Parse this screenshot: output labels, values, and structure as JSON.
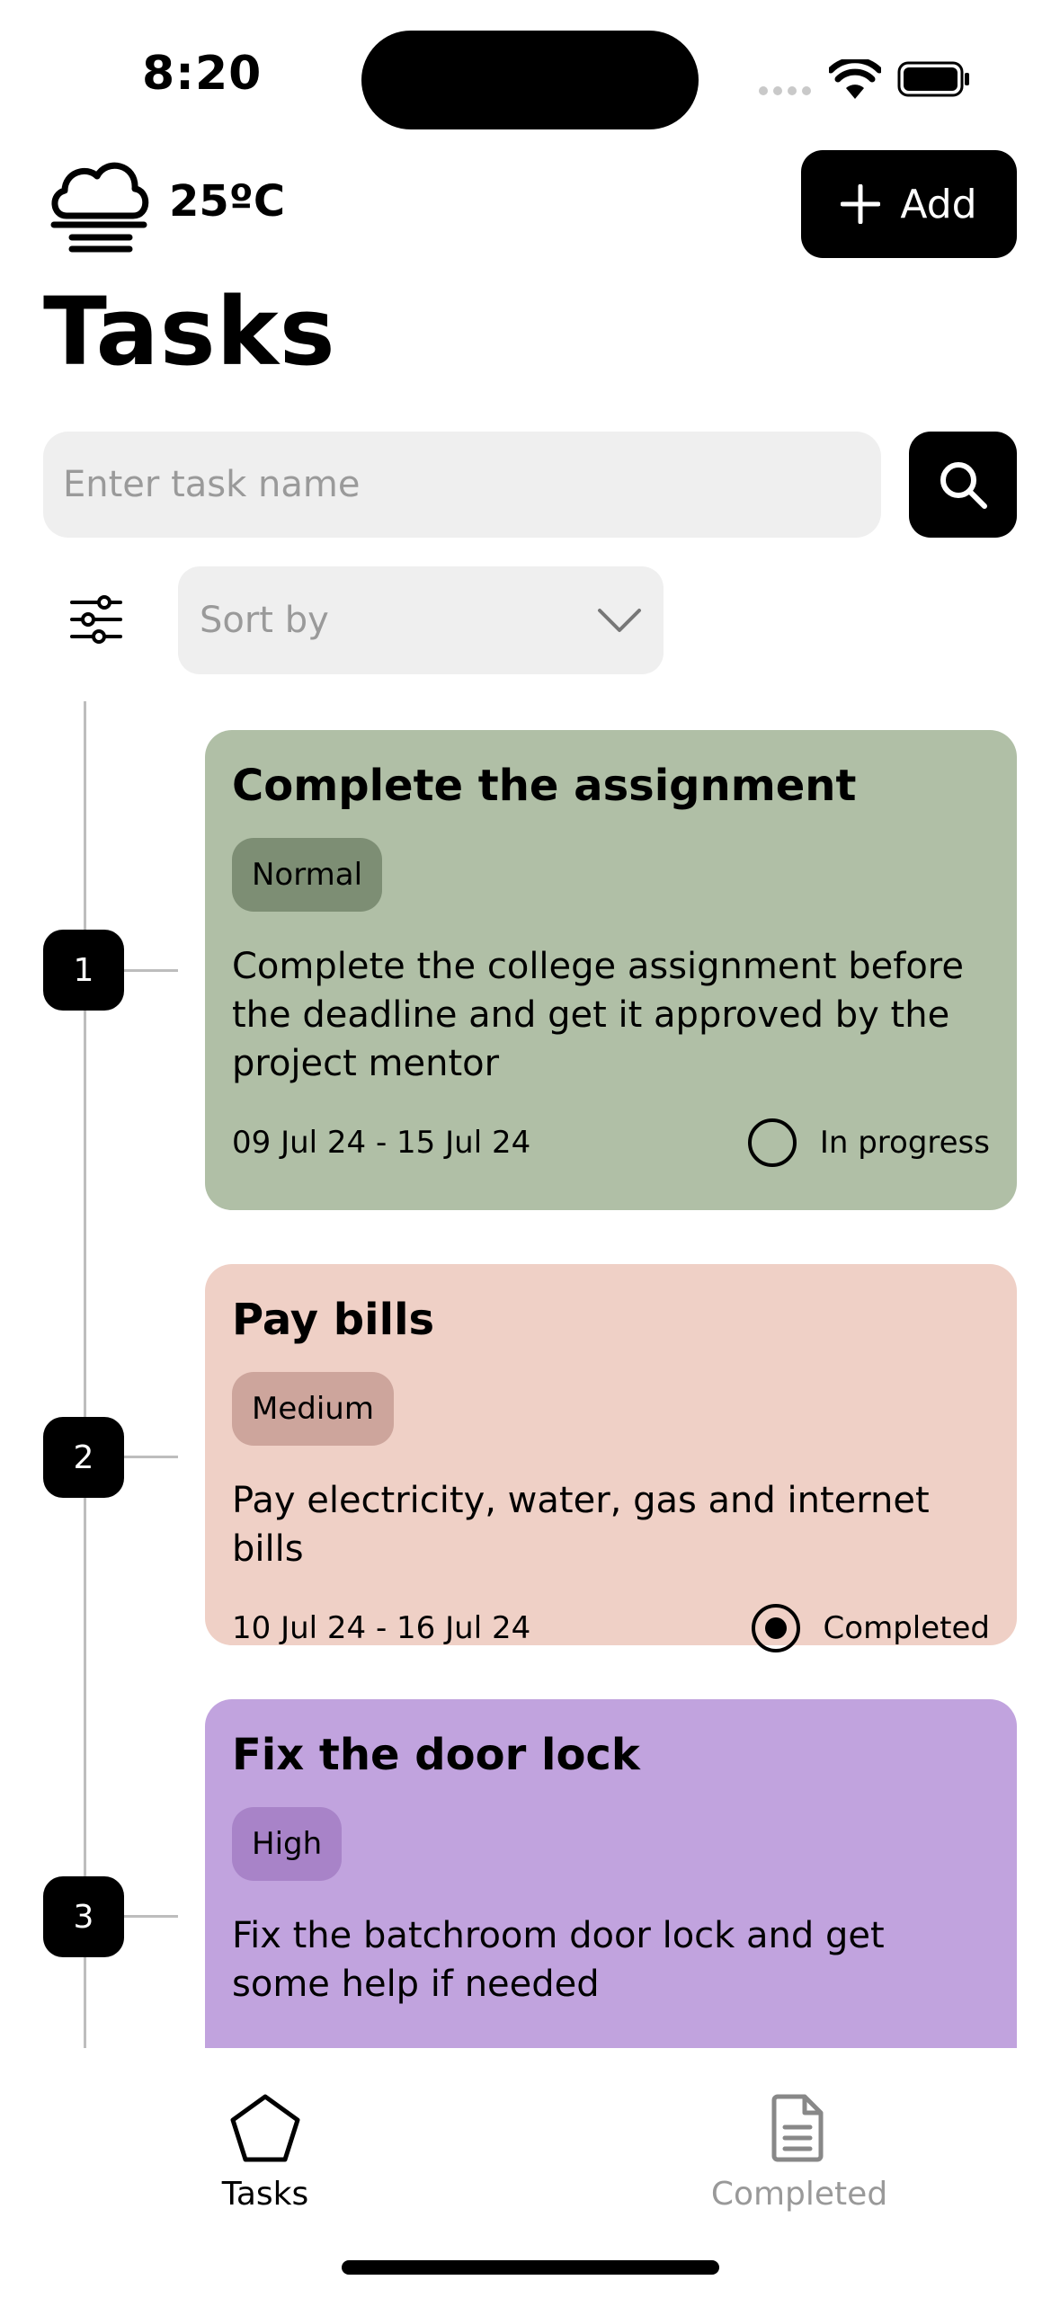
{
  "status_bar": {
    "time": "8:20"
  },
  "header": {
    "weather_icon": "cloud-fog-icon",
    "temperature": "25ºC",
    "add_label": "Add",
    "title": "Tasks"
  },
  "search": {
    "placeholder": "Enter task name"
  },
  "sort": {
    "placeholder": "Sort by"
  },
  "tasks": [
    {
      "number": "1",
      "title": "Complete the assignment",
      "priority": "Normal",
      "description": "Complete the college assignment before the deadline and get it approved by the project mentor",
      "dates": "09 Jul 24 - 15 Jul 24",
      "status": "In progress",
      "status_checked": false,
      "card_color": "#b0bfa6",
      "chip_color": "#7d8e74"
    },
    {
      "number": "2",
      "title": "Pay bills",
      "priority": "Medium",
      "description": "Pay electricity, water, gas and internet bills",
      "dates": "10 Jul 24 - 16 Jul 24",
      "status": "Completed",
      "status_checked": true,
      "card_color": "#efd0c6",
      "chip_color": "#cda59c"
    },
    {
      "number": "3",
      "title": "Fix the door lock",
      "priority": "High",
      "description": "Fix the batchroom door lock and get some help if needed",
      "card_color": "#c1a3de",
      "chip_color": "#a883c8"
    }
  ],
  "nav": {
    "tasks_label": "Tasks",
    "completed_label": "Completed",
    "active": "Tasks"
  }
}
